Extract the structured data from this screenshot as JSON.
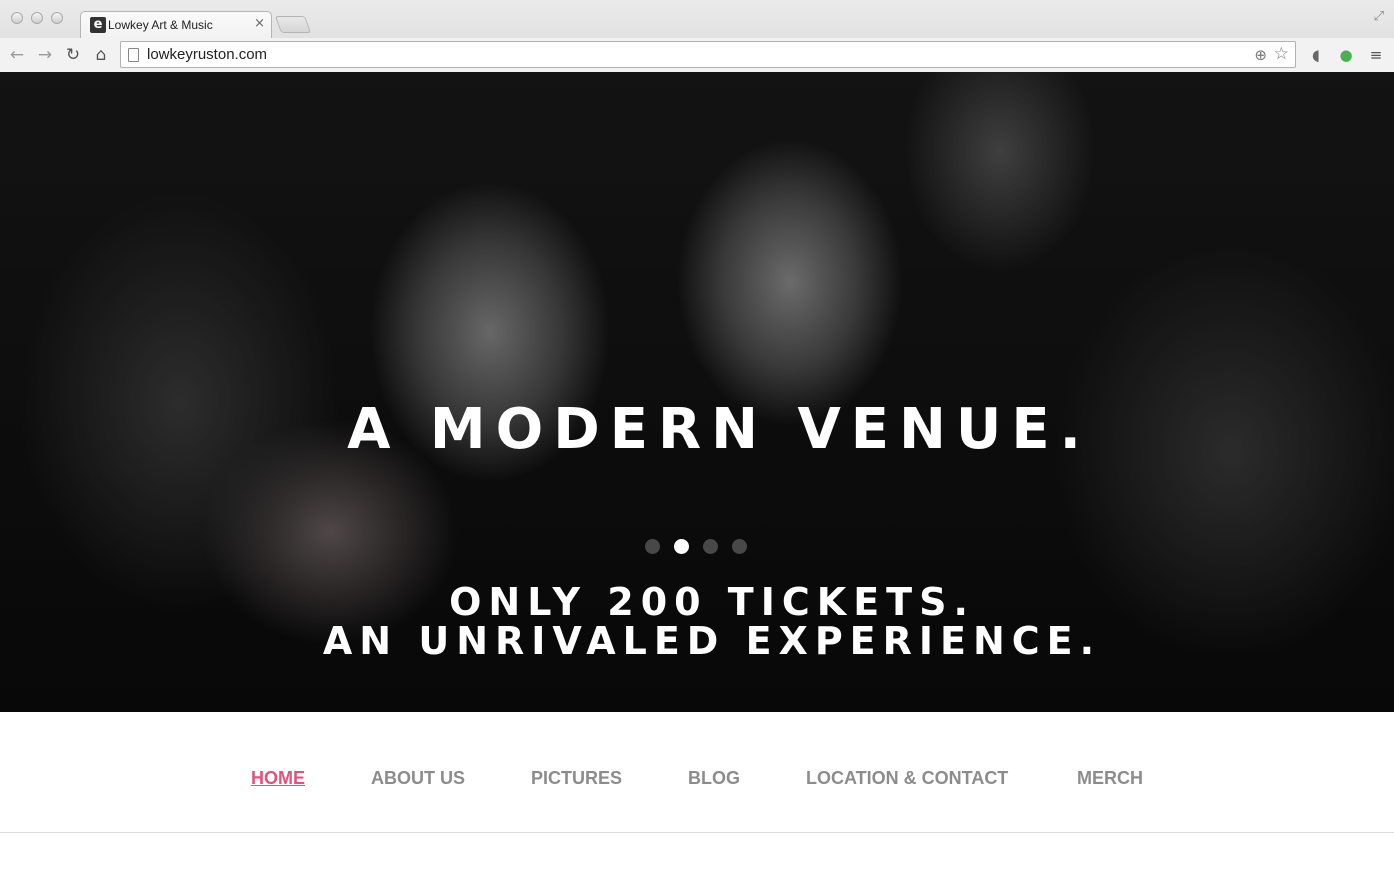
{
  "browser": {
    "tab_title": "Lowkey Art & Music",
    "tab_favicon": "e",
    "tab_close": "×",
    "url": "lowkeyruston.com"
  },
  "icons": {
    "back": "back-arrow-icon",
    "forward": "forward-arrow-icon",
    "reload": "reload-icon",
    "home": "home-icon",
    "zoom": "zoom-icon",
    "star": "bookmark-star-icon",
    "extension1": "audio-extension-icon",
    "extension2": "evernote-extension-icon",
    "menu": "menu-icon",
    "fullscreen": "fullscreen-icon"
  },
  "hero": {
    "headline": "A MODERN VENUE.",
    "sub_line1": "ONLY 200 TICKETS.",
    "sub_line2": "AN UNRIVALED EXPERIENCE.",
    "slide_count": 4,
    "active_slide": 2
  },
  "nav": {
    "items": [
      {
        "label": "HOME",
        "active": true
      },
      {
        "label": "ABOUT US",
        "active": false
      },
      {
        "label": "PICTURES",
        "active": false
      },
      {
        "label": "BLOG",
        "active": false
      },
      {
        "label": "LOCATION & CONTACT",
        "active": false
      },
      {
        "label": "MERCH",
        "active": false
      }
    ]
  },
  "colors": {
    "nav_active": "#e0527f",
    "nav_inactive": "#8c8c8c"
  }
}
